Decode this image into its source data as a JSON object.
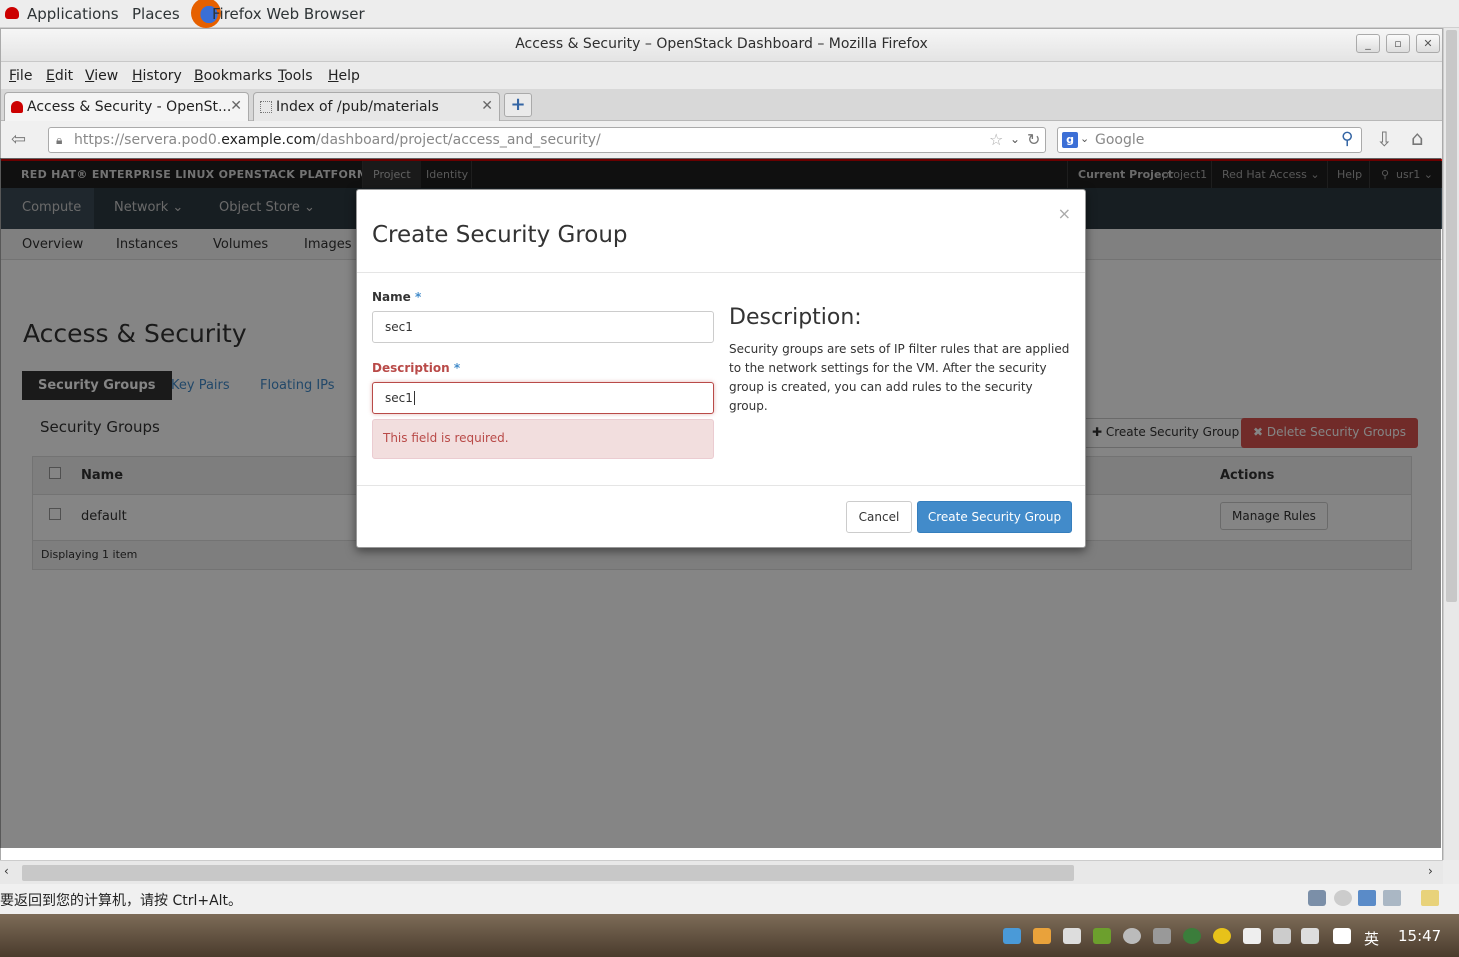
{
  "gnome": {
    "applications": "Applications",
    "places": "Places",
    "firefox": "Firefox Web Browser"
  },
  "window": {
    "title": "Access & Security – OpenStack Dashboard – Mozilla Firefox"
  },
  "menu": [
    "File",
    "Edit",
    "View",
    "History",
    "Bookmarks",
    "Tools",
    "Help"
  ],
  "tabs": [
    {
      "label": "Access & Security - OpenSt...",
      "close": "✕"
    },
    {
      "label": "Index of /pub/materials",
      "close": "✕"
    }
  ],
  "newtab": "+",
  "url": {
    "prefix": "https://servera.pod0.",
    "host": "example.com",
    "path": "/dashboard/project/access_and_security/"
  },
  "search": {
    "placeholder": "Google"
  },
  "rh": {
    "brand": "RED HAT® ENTERPRISE LINUX OPENSTACK PLATFORM",
    "project_tab": "Project",
    "identity_tab": "Identity",
    "current_project_label": "Current Project",
    "current_project_value": "project1",
    "red_hat_access": "Red Hat Access ⌄",
    "help": "Help",
    "user": "usr1 ⌄",
    "nav2": [
      "Compute",
      "Network ⌄",
      "Object Store ⌄"
    ],
    "nav3": [
      "Overview",
      "Instances",
      "Volumes",
      "Images"
    ]
  },
  "page": {
    "title": "Access & Security",
    "subtabs": [
      "Security Groups",
      "Key Pairs",
      "Floating IPs"
    ],
    "section_title": "Security Groups",
    "create_btn": "Create Security Group",
    "delete_btn": "Delete Security Groups",
    "col_name": "Name",
    "col_actions": "Actions",
    "row_name": "default",
    "row_action": "Manage Rules",
    "footer": "Displaying 1 item"
  },
  "modal": {
    "close": "×",
    "title": "Create Security Group",
    "name_label": "Name",
    "required": "*",
    "name_value": "sec1",
    "desc_label": "Description",
    "desc_value": "sec1",
    "error": "This field is required.",
    "info_title": "Description:",
    "info_text": "Security groups are sets of IP filter rules that are applied to the network settings for the VM. After the security group is created, you can add rules to the security group.",
    "cancel": "Cancel",
    "submit": "Create Security Group"
  },
  "status_text": "要返回到您的计算机，请按 Ctrl+Alt。",
  "taskbar": {
    "ime": "英",
    "clock": "15:47"
  },
  "colors": {
    "primary": "#428bca",
    "danger": "#d9534f",
    "error_text": "#b94a48",
    "rh_red": "#cc0000"
  }
}
